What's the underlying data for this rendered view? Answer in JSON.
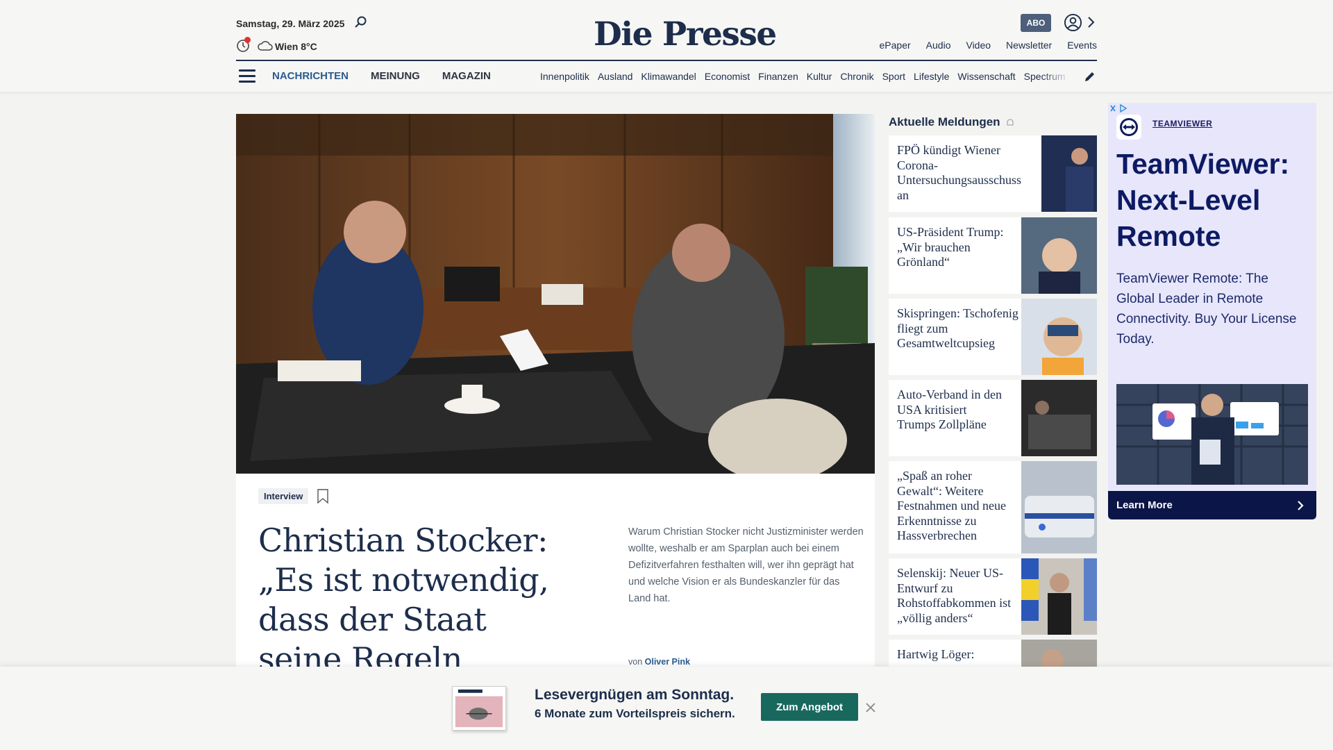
{
  "header": {
    "date": "Samstag, 29. März 2025",
    "weather": "Wien 8°C",
    "logo": "Die Presse",
    "abo": "ABO",
    "top_links": [
      "ePaper",
      "Audio",
      "Video",
      "Newsletter",
      "Events"
    ],
    "main_nav": [
      "NACHRICHTEN",
      "MEINUNG",
      "MAGAZIN"
    ],
    "sub_nav": [
      "Innenpolitik",
      "Ausland",
      "Klimawandel",
      "Economist",
      "Finanzen",
      "Kultur",
      "Chronik",
      "Sport",
      "Lifestyle",
      "Wissenschaft",
      "Spectrum"
    ]
  },
  "article": {
    "tag": "Interview",
    "headline": "Christian Stocker: „Es ist notwendig, dass der Staat seine Regeln wieder durchsetzt“",
    "teaser": "Warum Christian Stocker nicht Justizminister werden wollte, weshalb er am Sparplan auch bei einem Defizitverfahren festhalten will, wer ihn geprägt hat und welche Vision er als Bundeskanzler für das Land hat.",
    "author_prefix": "von",
    "author": "Oliver Pink"
  },
  "news": {
    "title": "Aktuelle Meldungen",
    "items": [
      {
        "text": "FPÖ kündigt Wiener Corona-Untersuchungsausschuss an"
      },
      {
        "text": "US-Präsident Trump: „Wir brauchen Grönland“"
      },
      {
        "text": "Skispringen: Tschofenig fliegt zum Gesamtweltcupsieg"
      },
      {
        "text": "Auto-Verband in den USA kritisiert Trumps Zollpläne"
      },
      {
        "text": "„Spaß an roher Gewalt“: Weitere Festnahmen und neue Erkenntnisse zu Hassverbrechen"
      },
      {
        "text": "Selenskij: Neuer US-Entwurf zu Rohstoffabkommen ist „völlig anders“"
      },
      {
        "text": "Hartwig Löger:"
      }
    ]
  },
  "ad": {
    "brand": "TEAMVIEWER",
    "headline": "TeamViewer: Next-Level Remote",
    "body": "TeamViewer Remote: The Global Leader in Remote Connectivity. Buy Your License Today.",
    "cta": "Learn More"
  },
  "banner": {
    "line1": "Lesevergnügen am Sonntag.",
    "line2": "6 Monate zum Vorteilspreis sichern.",
    "button": "Zum Angebot"
  },
  "colors": {
    "navy": "#1d2d4b",
    "accent_blue": "#2c5b8e",
    "banner_button": "#19685e",
    "ad_background": "#e7e6fb"
  }
}
